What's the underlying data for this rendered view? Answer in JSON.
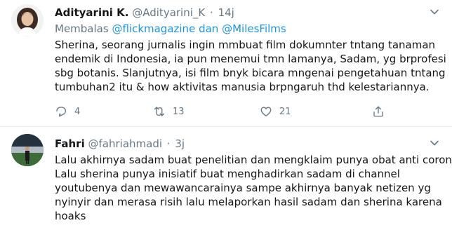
{
  "tweets": [
    {
      "author_name": "Adityarini K.",
      "handle": "@Adityarini_K",
      "time": "14j",
      "reply_prefix": "Membalas",
      "reply_to_1": "@flickmagazine",
      "reply_joiner": "dan",
      "reply_to_2": "@MilesFilms",
      "lines": [
        "Sherina, seorang jurnalis ingin mmbuat film dokumnter tntang tanaman",
        "endemik di Indonesia, ia pun menemui tmn lamanya, Sadam, yg brprofesi",
        "sbg botanis. Slanjutnya, isi film bnyk bicara mngenai pengetahuan tntang",
        "tumbuhan2 itu & how aktivitas manusia brpngaruh thd kelestariannya."
      ],
      "actions": {
        "replies": "4",
        "retweets": "13",
        "likes": "21"
      }
    },
    {
      "author_name": "Fahri",
      "handle": "@fahriahmadi",
      "time": "3j",
      "lines": [
        "Lalu akhirnya sadam buat penelitian dan mengklaim punya obat anti corona.",
        "Lalu sherina punya inisiatif buat menghadirkan sadam di channel",
        "youtubenya dan mewawancarainya sampe akhirnya banyak netizen yg",
        "nyinyir dan merasa risih lalu melaporkan hasil sadam dan sherina karena",
        "hoaks"
      ]
    }
  ],
  "icons": {
    "reply": "reply-icon",
    "retweet": "retweet-icon",
    "like": "heart-icon",
    "share": "share-icon",
    "caret": "chevron-down-icon"
  },
  "colors": {
    "link": "#1b95e0",
    "muted": "#657786",
    "text": "#14171a",
    "divider": "#e6ecf0"
  }
}
